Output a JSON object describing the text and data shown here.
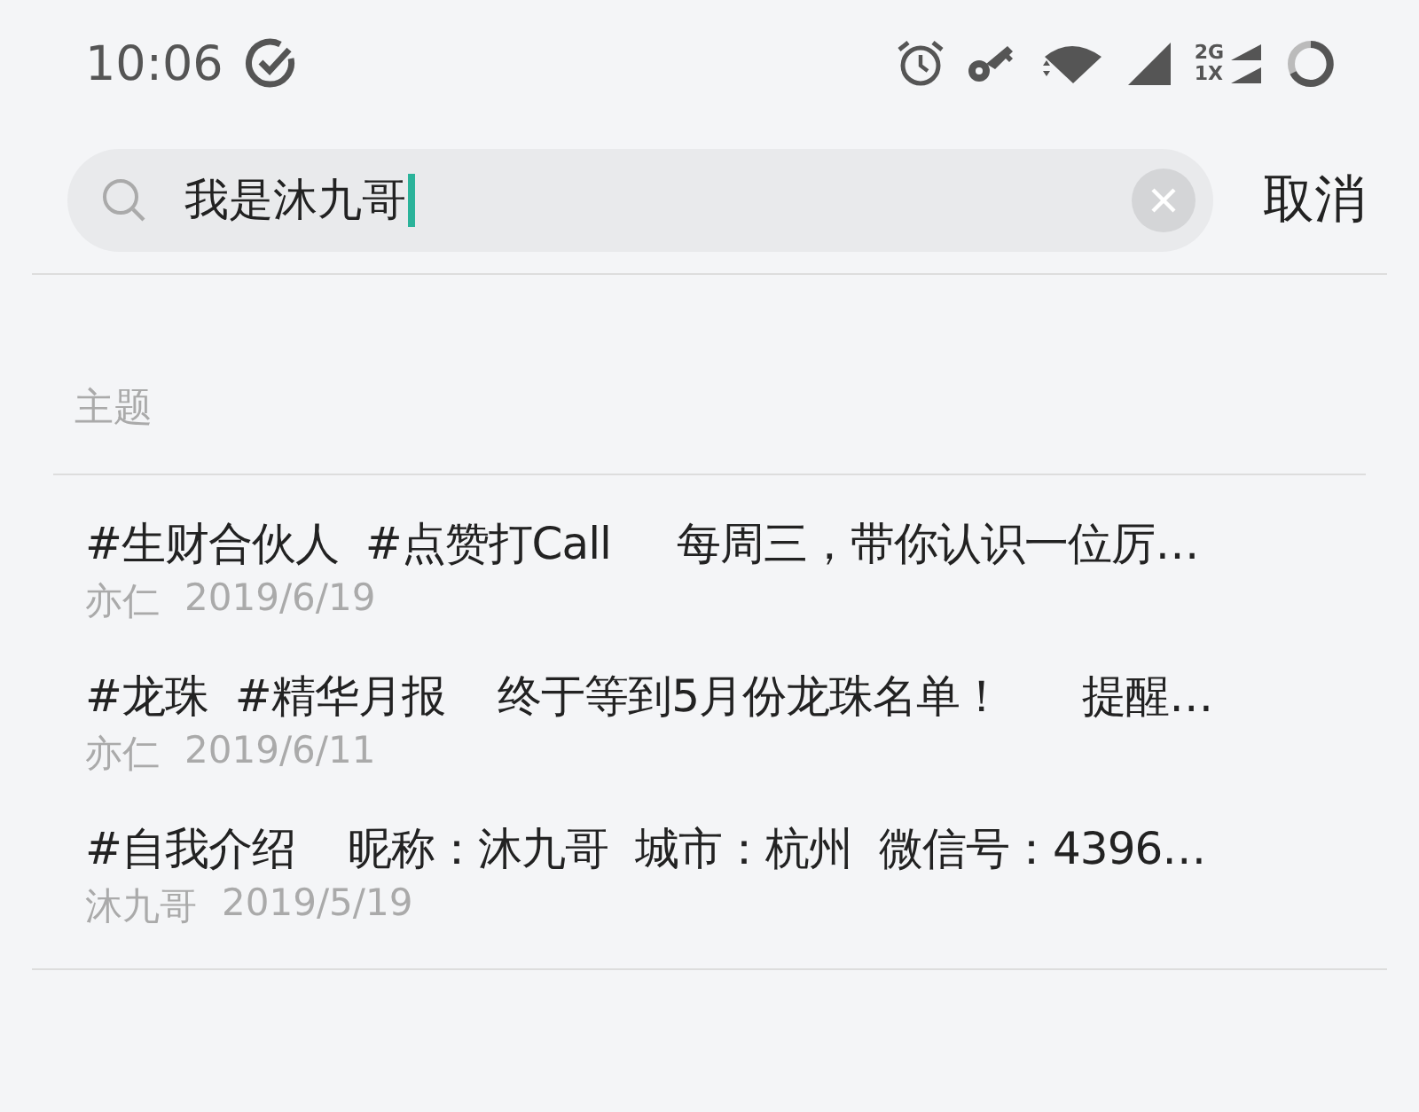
{
  "status_bar": {
    "time": "10:06",
    "network_labels": [
      "2G",
      "1X"
    ]
  },
  "search": {
    "value": "我是沐九哥",
    "cancel": "取消"
  },
  "section": {
    "title": "主题"
  },
  "results": [
    {
      "title": "#生财合伙人  #点赞打Call     每周三，带你认识一位厉…",
      "author": "亦仁",
      "date": "2019/6/19"
    },
    {
      "title": "#龙珠  #精华月报    终于等到5月份龙珠名单！      提醒…",
      "author": "亦仁",
      "date": "2019/6/11"
    },
    {
      "title": "#自我介绍    昵称：沐九哥  城市：杭州  微信号：4396…",
      "author": "沐九哥",
      "date": "2019/5/19"
    }
  ]
}
